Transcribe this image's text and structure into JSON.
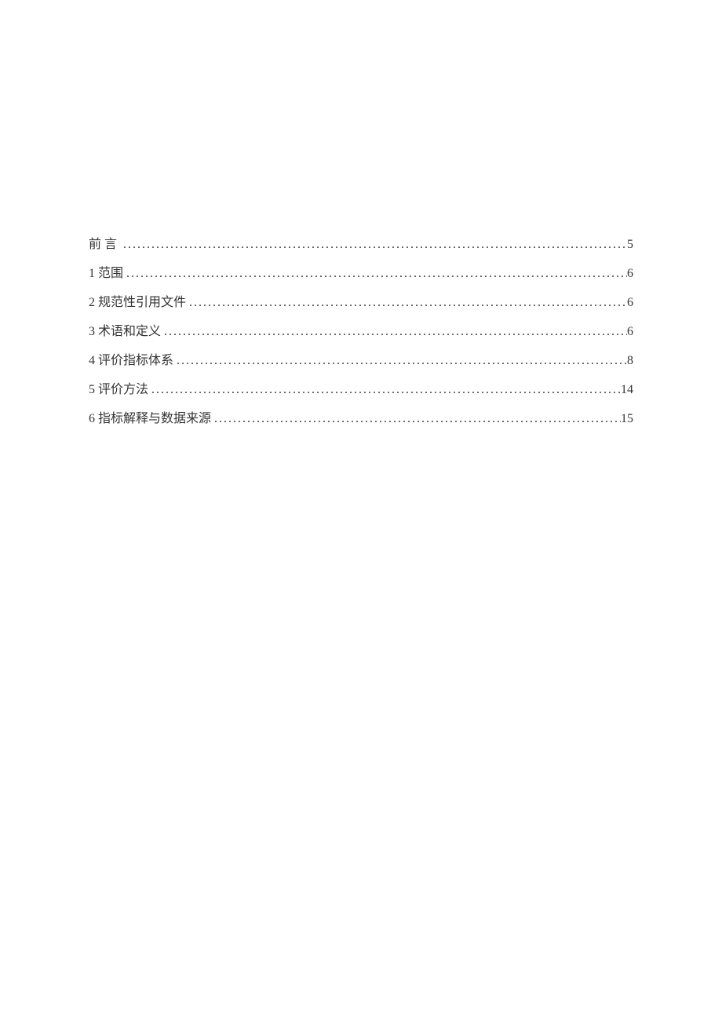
{
  "toc": {
    "entries": [
      {
        "label": "前言",
        "page": "5",
        "preface": true
      },
      {
        "label": "1 范围",
        "page": "6",
        "preface": false
      },
      {
        "label": "2 规范性引用文件",
        "page": "6",
        "preface": false
      },
      {
        "label": "3 术语和定义",
        "page": "6",
        "preface": false
      },
      {
        "label": "4 评价指标体系",
        "page": "8",
        "preface": false
      },
      {
        "label": "5 评价方法",
        "page": "14",
        "preface": false
      },
      {
        "label": "6 指标解释与数据来源",
        "page": "15",
        "preface": false
      }
    ]
  }
}
